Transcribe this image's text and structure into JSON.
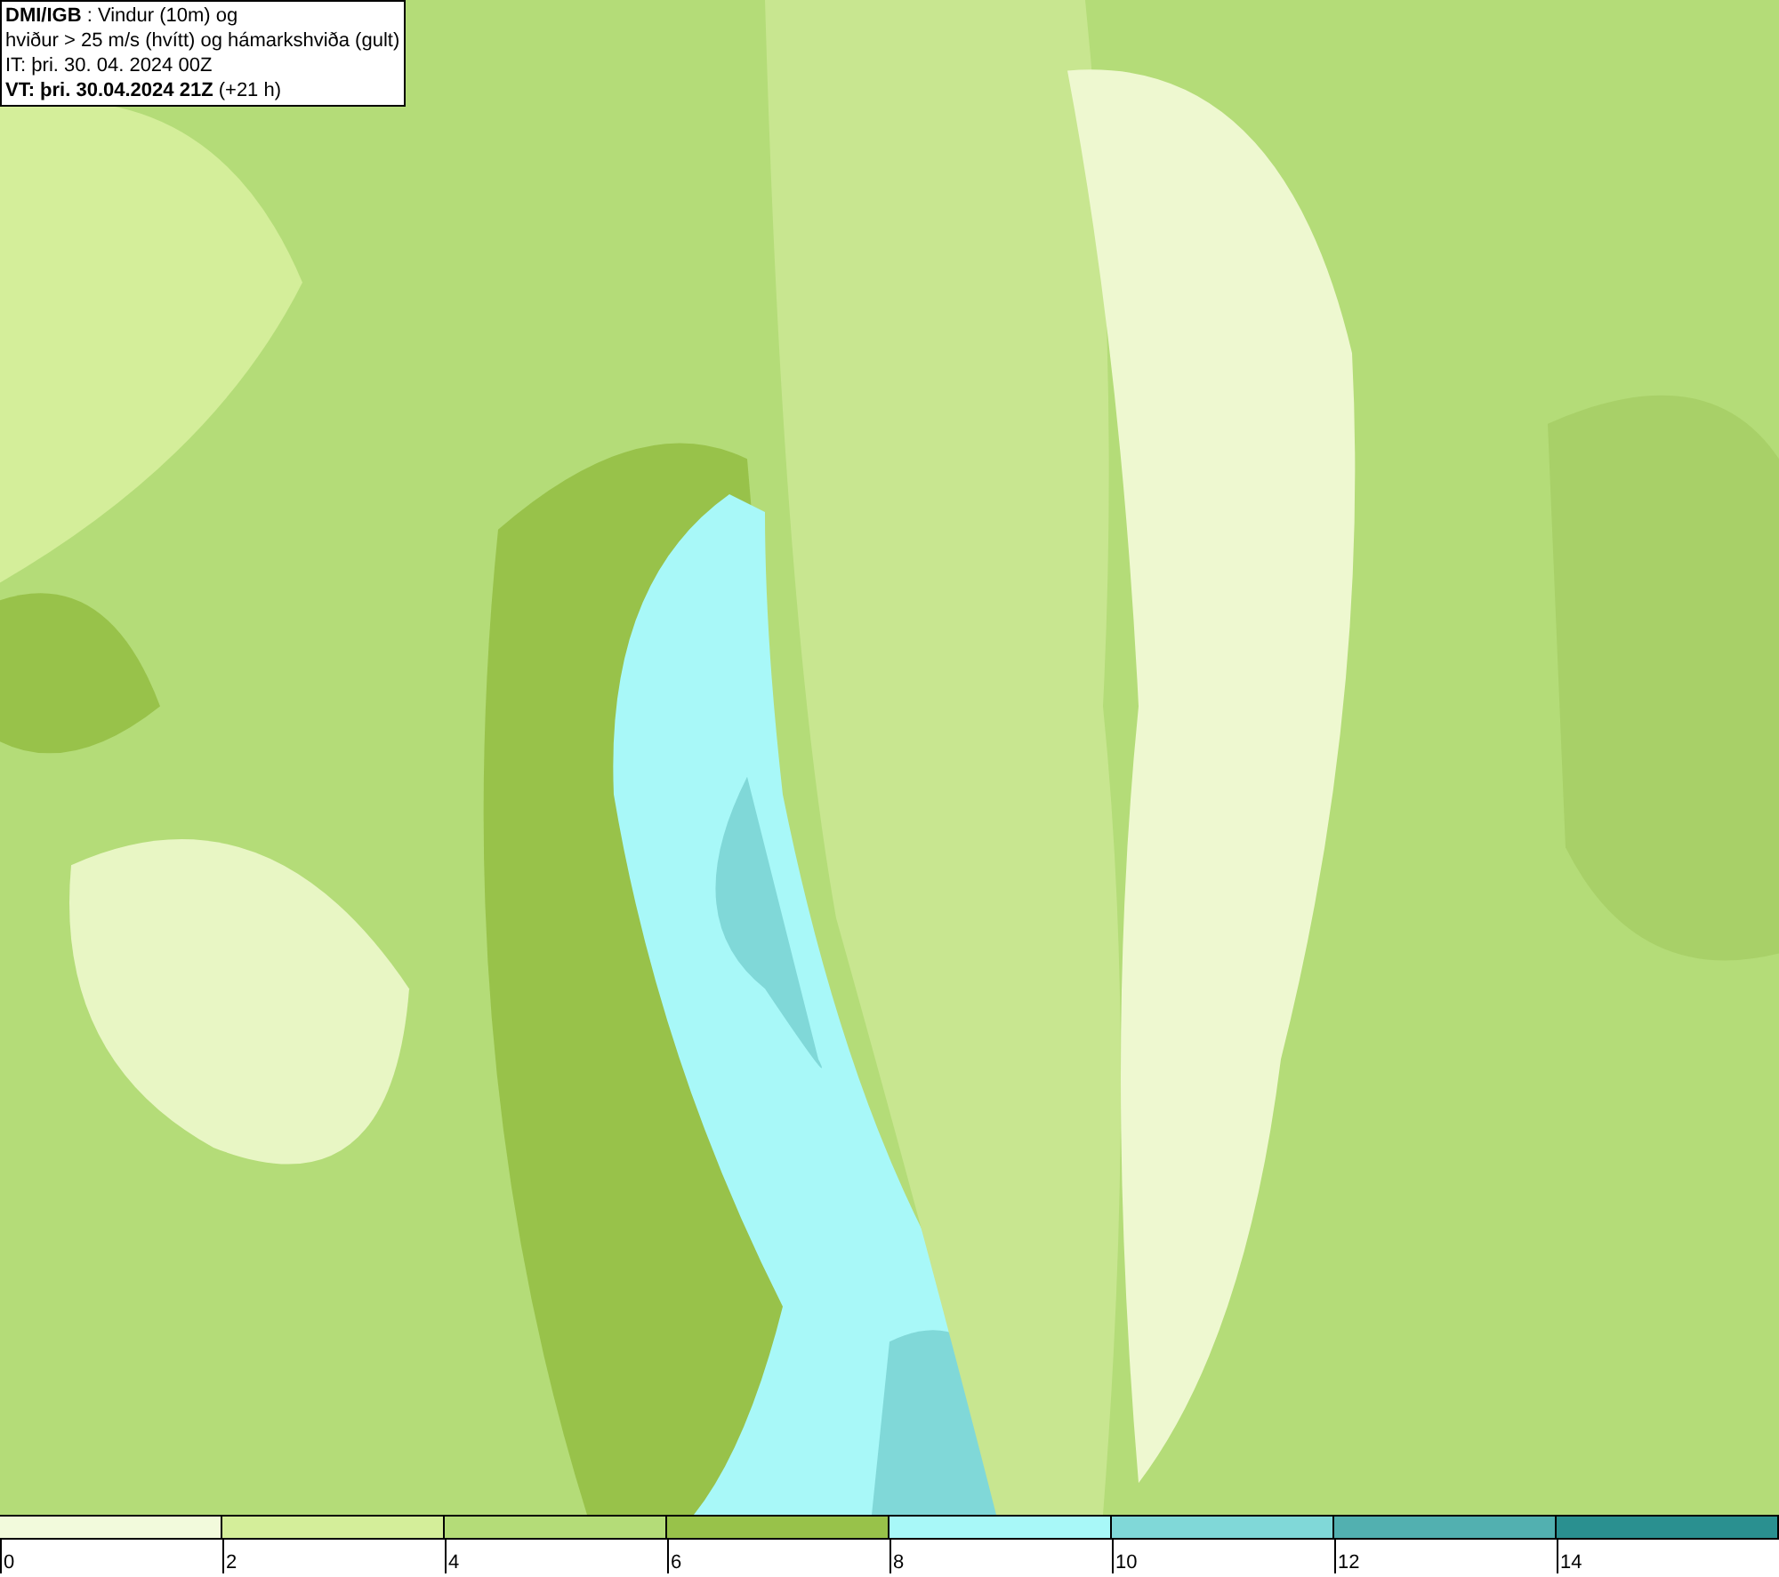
{
  "info_box": {
    "lines": [
      "**DMI/IGB** : Vindur (10m) og",
      "hviður > 25 m/s (hvítt) og hámarkshviða (gult)",
      "IT: þri. 30. 04. 2024 00Z",
      "**VT: þri. 30.04.2024 21Z** (+21 h)"
    ]
  },
  "legend": {
    "segments": [
      {
        "color": "#f2fadc"
      },
      {
        "color": "#d4ee9a"
      },
      {
        "color": "#b4dc78"
      },
      {
        "color": "#98c24a"
      },
      {
        "color": "#a8f8f8"
      },
      {
        "color": "#80d8d8"
      },
      {
        "color": "#52b0b0"
      },
      {
        "color": "#2a9090"
      }
    ],
    "ticks": [
      "0",
      "2",
      "4",
      "6",
      "8",
      "10",
      "12",
      "14"
    ]
  }
}
